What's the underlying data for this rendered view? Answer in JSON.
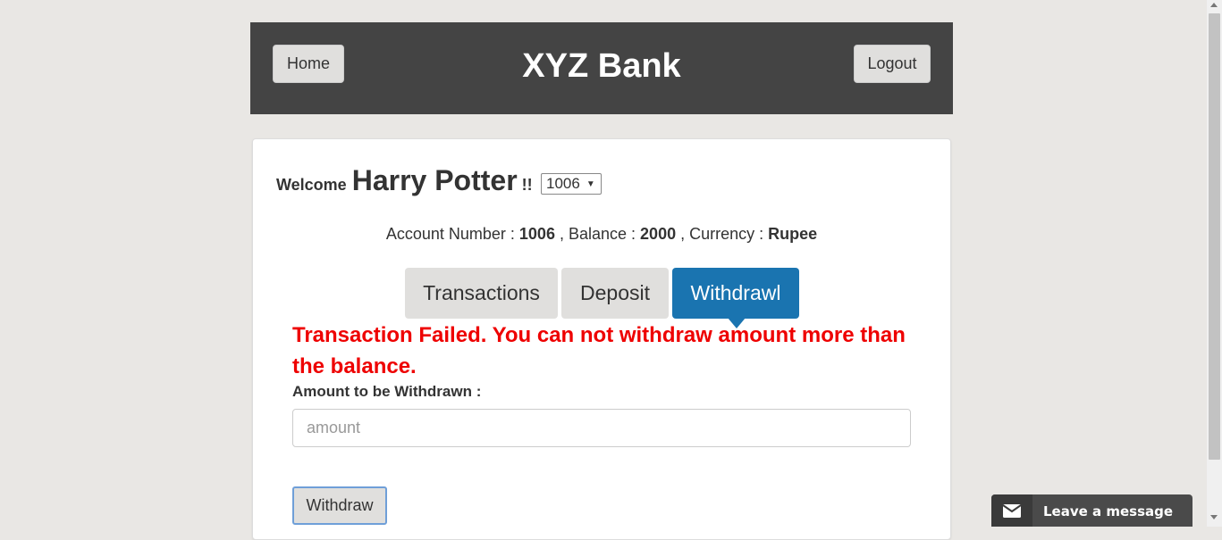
{
  "header": {
    "home_label": "Home",
    "brand": "XYZ Bank",
    "logout_label": "Logout"
  },
  "welcome": {
    "prefix": "Welcome",
    "customer_name": "Harry Potter",
    "suffix": "!!"
  },
  "account_select": {
    "selected": "1006"
  },
  "account_info": {
    "account_label": "Account Number :",
    "account_number": "1006",
    "balance_label": ", Balance :",
    "balance": "2000",
    "currency_label": ", Currency :",
    "currency": "Rupee"
  },
  "tabs": [
    {
      "label": "Transactions",
      "active": false
    },
    {
      "label": "Deposit",
      "active": false
    },
    {
      "label": "Withdrawl",
      "active": true
    }
  ],
  "withdraw_form": {
    "error_message": "Transaction Failed. You can not withdraw amount more than the balance.",
    "amount_label": "Amount to be Withdrawn :",
    "amount_placeholder": "amount",
    "amount_value": "",
    "submit_label": "Withdraw"
  },
  "chat_widget": {
    "label": "Leave a message",
    "icon": "envelope-icon"
  },
  "colors": {
    "header_bg": "#444444",
    "active_tab": "#1a74b0",
    "error_text": "#ee0000",
    "page_bg": "#e9e7e4"
  }
}
